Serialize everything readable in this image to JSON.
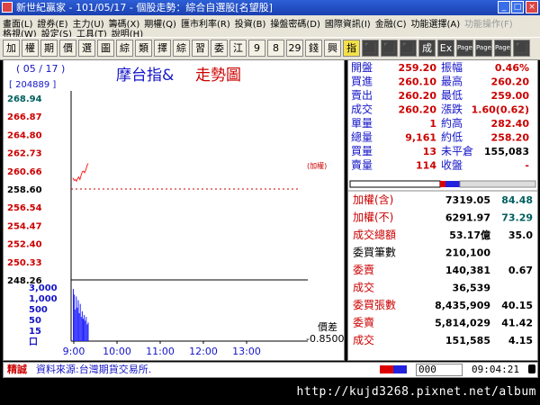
{
  "window": {
    "title": "新世紀贏家 - 101/05/17 - 個股走勢：綜合自選股[名望股]"
  },
  "menu": {
    "row1": [
      "畫面(L)",
      "證券(E)",
      "主力(U)",
      "籌碼(X)",
      "期權(Q)",
      "匯市利率(R)",
      "投資(B)",
      "操盤密碼(D)",
      "國際資訊(I)",
      "金融(C)",
      "功能選擇(A)",
      "功能操作(F)"
    ],
    "row2": [
      "格視(W)",
      "設定(S)",
      "工具(T)",
      "說明(H)"
    ]
  },
  "toolbar": {
    "buttons": [
      "加",
      "權",
      "期",
      "價",
      "選",
      "圖",
      "綜",
      "類",
      "擇",
      "綜",
      "習",
      "委",
      "江",
      "9",
      "8",
      "29",
      "錢",
      "興",
      "指",
      "⬛",
      "⬛",
      "⬛",
      "成",
      "Ex",
      "Page",
      "Page",
      "Page",
      "⬛"
    ]
  },
  "chart": {
    "date": "( 05 / 17 )",
    "volume_total": "[ 204889 ]",
    "title_a": "摩台指&",
    "title_b": "走勢圖",
    "plus_label": "(加權)",
    "spread_label": "價差",
    "spread_value": "-0.8500",
    "price_ticks": [
      "268.94",
      "266.87",
      "264.80",
      "262.73",
      "260.66",
      "258.60",
      "256.54",
      "254.47",
      "252.40",
      "250.33",
      "248.26"
    ],
    "volume_ticks": [
      "3,000",
      "1,000",
      "500",
      "50",
      "15",
      "口"
    ],
    "time_ticks": [
      "9:00",
      "10:00",
      "11:00",
      "12:00",
      "13:00"
    ]
  },
  "chart_data": {
    "type": "line",
    "title": "摩台指& 走勢圖",
    "ylim": [
      248.26,
      268.94
    ],
    "x_labels": [
      "9:00",
      "10:00",
      "11:00",
      "12:00",
      "13:00"
    ],
    "series": [
      {
        "values": [
          259.5,
          259.2,
          259.3,
          259.1,
          259.4,
          259.6,
          259.3,
          259.8,
          260.2,
          260.3,
          260.1,
          260.4,
          260.9,
          261.2
        ]
      }
    ],
    "volume": [
      2800,
      2500,
      1700,
      2400,
      1800,
      2200,
      1500,
      2000,
      1300,
      1600,
      1200,
      1400,
      1100,
      1300,
      900,
      1000
    ]
  },
  "quote": {
    "rows": [
      {
        "l1": "開盤",
        "v1": "259.20",
        "l2": "振幅",
        "v2": "0.46%"
      },
      {
        "l1": "買進",
        "v1": "260.10",
        "l2": "最高",
        "v2": "260.20"
      },
      {
        "l1": "賣出",
        "v1": "260.20",
        "l2": "最低",
        "v2": "259.00"
      },
      {
        "l1": "成交",
        "v1": "260.20",
        "l2": "漲跌",
        "v2": "1.60(0.62)"
      },
      {
        "l1": "單量",
        "v1": "1",
        "l2": "約高",
        "v2": "282.40"
      },
      {
        "l1": "總量",
        "v1": "9,161",
        "l2": "約低",
        "v2": "258.20"
      },
      {
        "l1": "買量",
        "v1": "13",
        "l2": "未平倉",
        "v2": "155,083"
      },
      {
        "l1": "賣量",
        "v1": "114",
        "l2": "收盤",
        "v2": "-"
      }
    ]
  },
  "stats": {
    "rows": [
      {
        "label": "加權(含)",
        "value": "7319.05",
        "extra": "84.48"
      },
      {
        "label": "加權(不)",
        "value": "6291.97",
        "extra": "73.29"
      },
      {
        "label": "成交總額",
        "value": "53.17億",
        "extra": "35.0"
      },
      {
        "label": "委買筆數",
        "value": "210,100",
        "extra": ""
      },
      {
        "label": "委賣",
        "value": "140,381",
        "extra": "0.67"
      },
      {
        "label": "成交",
        "value": "36,539",
        "extra": ""
      },
      {
        "label": "委買張數",
        "value": "8,435,909",
        "extra": "40.15"
      },
      {
        "label": "委賣",
        "value": "5,814,029",
        "extra": "41.42"
      },
      {
        "label": "成交",
        "value": "151,585",
        "extra": "4.15"
      }
    ]
  },
  "status": {
    "tag": "精誠",
    "source": "資料來源:台灣期貨交易所.",
    "input_value": "000",
    "clock": "09:04:21"
  },
  "footer": {
    "url": "http://kujd3268.pixnet.net/album"
  },
  "colors": {
    "price_line": "#ff2222",
    "volume_bar": "#2222ff",
    "axis_blue": "#00ffff",
    "label_blue": "#1414c8",
    "label_red": "#cc0000"
  }
}
